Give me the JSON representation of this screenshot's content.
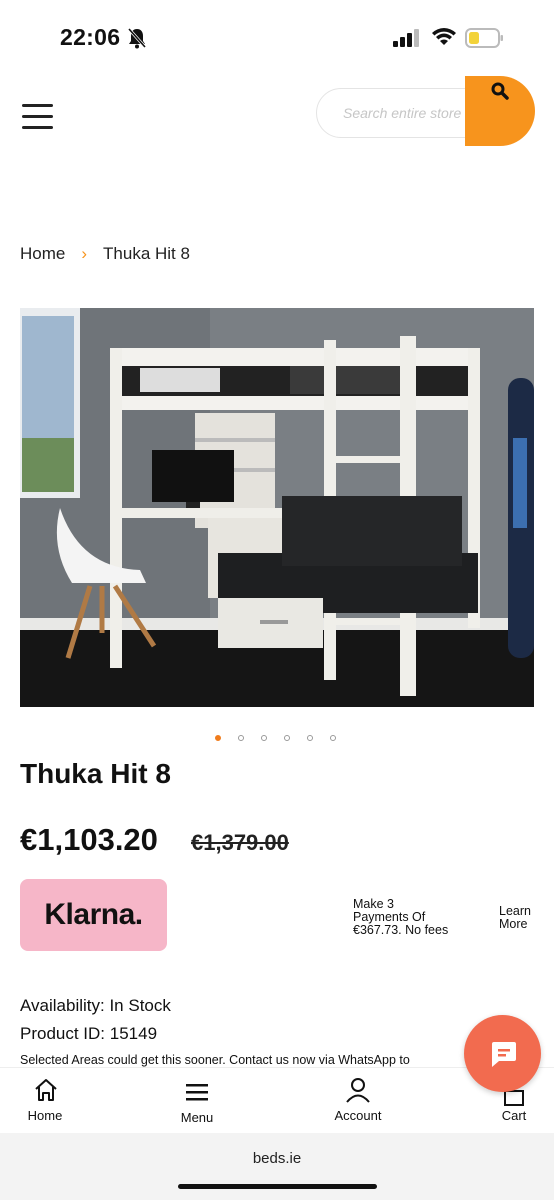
{
  "status_bar": {
    "time": "22:06"
  },
  "header": {
    "search_placeholder": "Search entire store",
    "menu_icon": "hamburger-icon",
    "search_icon": "search-icon",
    "accent_color": "#f7941d"
  },
  "breadcrumb": {
    "home": "Home",
    "separator": "›",
    "current": "Thuka Hit 8"
  },
  "gallery": {
    "image_count": 6,
    "active_index": 0
  },
  "product": {
    "title": "Thuka Hit 8",
    "price": "€1,103.20",
    "old_price": "€1,379.00",
    "klarna_label": "Klarna.",
    "klarna_line1": "Make 3",
    "klarna_line2": "Payments Of",
    "klarna_line3": "€367.73. No fees",
    "learn_more_line1": "Learn",
    "learn_more_line2": "More",
    "availability": "Availability: In Stock",
    "product_id": "Product ID: 15149",
    "notice": "Selected Areas could get this sooner. Contact us now via WhatsApp to"
  },
  "bottom_nav": {
    "home": "Home",
    "menu": "Menu",
    "account": "Account",
    "cart": "Cart"
  },
  "browser": {
    "url": "beds.ie"
  },
  "colors": {
    "accent": "#f7941d",
    "klarna_pink": "#f6b6c8",
    "chat_button": "#f26b4f"
  }
}
